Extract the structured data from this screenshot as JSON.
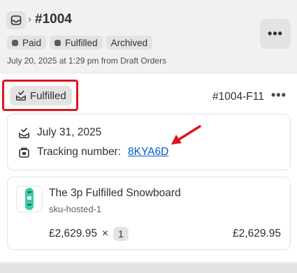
{
  "header": {
    "breadcrumb_chevron": "›",
    "order_title": "#1004",
    "badges": [
      {
        "label": "Paid",
        "icon": "status-dot-icon"
      },
      {
        "label": "Fulfilled",
        "icon": "status-dot-icon"
      },
      {
        "label": "Archived",
        "icon": ""
      }
    ],
    "subline": "July 20, 2025 at 1:29 pm from Draft Orders",
    "more_label": "•••"
  },
  "fulfillment": {
    "status_label": "Fulfilled",
    "status_icon": "fulfilled-box-icon",
    "fulfillment_id": "#1004-F11",
    "more_label": "•••",
    "date": "July 31, 2025",
    "date_icon": "fulfilled-box-icon",
    "tracking_label": "Tracking number:",
    "tracking_number": "8KYA6D",
    "tracking_icon": "tracking-icon"
  },
  "line_item": {
    "title": "The 3p Fulfilled Snowboard",
    "sku": "sku-hosted-1",
    "unit_price": "£2,629.95",
    "times": "×",
    "quantity": "1",
    "total": "£2,629.95",
    "thumbnail_icon": "snowboard-thumbnail"
  },
  "colors": {
    "accent_link": "#005bd3",
    "highlight_red": "#e0141e",
    "badge_bg": "#e3e3e3",
    "page_bg": "#f1f1f1"
  }
}
